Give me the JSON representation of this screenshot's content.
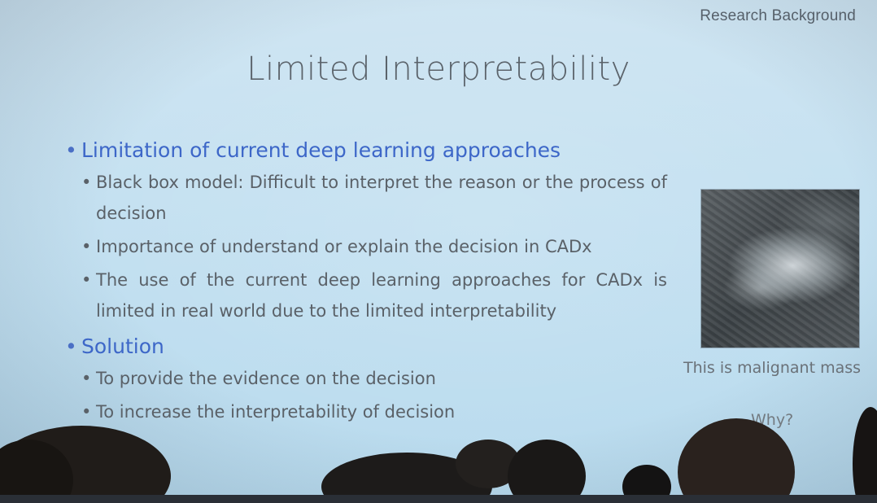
{
  "slide": {
    "section_label": "Research Background",
    "title": "Limited Interpretability",
    "bullets": [
      {
        "label": "Limitation of current deep learning approaches",
        "sub": [
          "Black box model: Difficult to interpret the reason or the process of decision",
          "Importance of understand or explain the decision in CADx",
          "The use of the current deep learning approaches for CADx is limited in real world due to the limited interpretability"
        ]
      },
      {
        "label": "Solution",
        "sub": [
          "To provide the evidence on the decision",
          "To increase the interpretability of decision"
        ]
      }
    ],
    "image_caption": "This is malignant mass",
    "question": "Why?"
  },
  "colors": {
    "slide_background": "#c5e1f1",
    "level1_text": "#3d67c8",
    "body_text": "#5a6168",
    "audience_heads": "#1c1a18"
  }
}
